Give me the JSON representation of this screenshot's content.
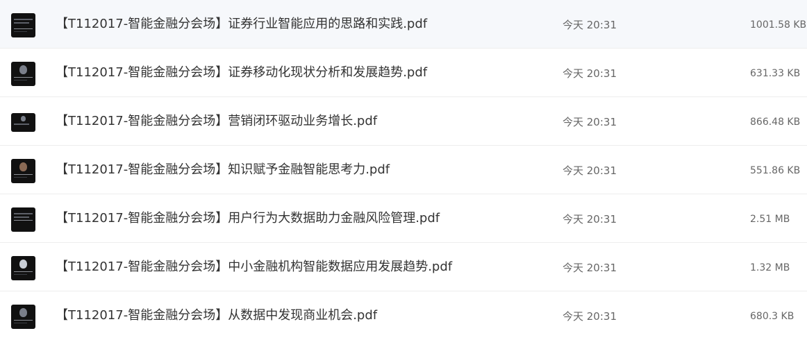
{
  "files": [
    {
      "name": "【T112017-智能金融分会场】证券行业智能应用的思路和实践.pdf",
      "date": "今天 20:31",
      "size": "1001.58 KB",
      "thumbnail_icon": "pdf-cover-thumbnail"
    },
    {
      "name": "【T112017-智能金融分会场】证券移动化现状分析和发展趋势.pdf",
      "date": "今天 20:31",
      "size": "631.33 KB",
      "thumbnail_icon": "pdf-cover-thumbnail"
    },
    {
      "name": "【T112017-智能金融分会场】营销闭环驱动业务增长.pdf",
      "date": "今天 20:31",
      "size": "866.48 KB",
      "thumbnail_icon": "pdf-cover-thumbnail"
    },
    {
      "name": "【T112017-智能金融分会场】知识赋予金融智能思考力.pdf",
      "date": "今天 20:31",
      "size": "551.86 KB",
      "thumbnail_icon": "pdf-cover-thumbnail"
    },
    {
      "name": "【T112017-智能金融分会场】用户行为大数据助力金融风险管理.pdf",
      "date": "今天 20:31",
      "size": "2.51 MB",
      "thumbnail_icon": "pdf-cover-thumbnail"
    },
    {
      "name": "【T112017-智能金融分会场】中小金融机构智能数据应用发展趋势.pdf",
      "date": "今天 20:31",
      "size": "1.32 MB",
      "thumbnail_icon": "pdf-cover-thumbnail"
    },
    {
      "name": "【T112017-智能金融分会场】从数据中发现商业机会.pdf",
      "date": "今天 20:31",
      "size": "680.3 KB",
      "thumbnail_icon": "pdf-cover-thumbnail"
    }
  ],
  "colors": {
    "text_primary": "#333333",
    "text_secondary": "#666666",
    "row_divider": "#ededed",
    "thumbnail_bg": "#111111"
  }
}
